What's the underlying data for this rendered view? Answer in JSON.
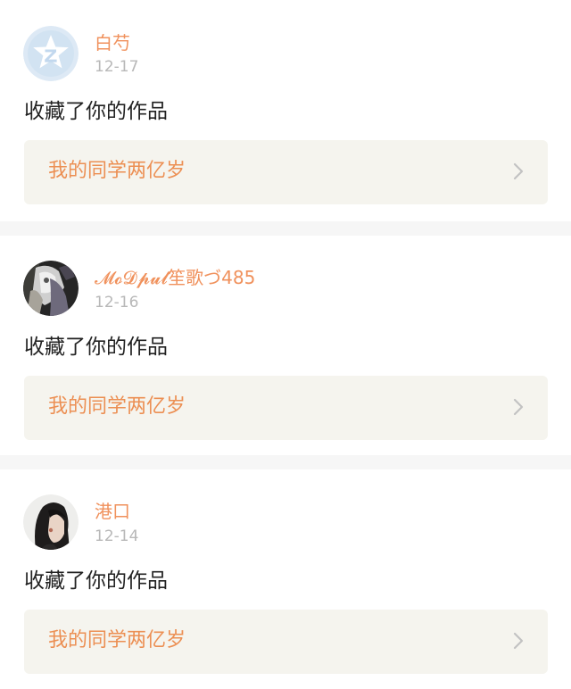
{
  "items": [
    {
      "username": "白芍",
      "date": "12-17",
      "action": "收藏了你的作品",
      "work_title": "我的同学两亿岁",
      "avatar_icon": "qzone-default-avatar-icon"
    },
    {
      "username": "𝓜𝓸𝓓𝓹𝓾𝓵笙歌づ485",
      "date": "12-16",
      "action": "收藏了你的作品",
      "work_title": "我的同学两亿岁",
      "avatar_icon": "anime-avatar-icon"
    },
    {
      "username": "港口",
      "date": "12-14",
      "action": "收藏了你的作品",
      "work_title": "我的同学两亿岁",
      "avatar_icon": "portrait-avatar-icon"
    }
  ],
  "colors": {
    "username": "#f0915c",
    "work_title": "#ec8f53",
    "date": "#b8b8b8",
    "card_bg": "#ffffff",
    "separator": "#f6f6f6",
    "link_bg": "#f5f4ee"
  }
}
